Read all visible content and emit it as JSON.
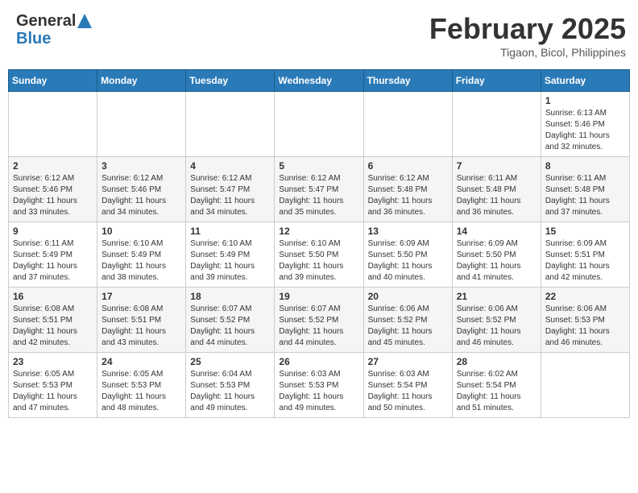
{
  "header": {
    "logo_general": "General",
    "logo_blue": "Blue",
    "month_title": "February 2025",
    "location": "Tigaon, Bicol, Philippines"
  },
  "calendar": {
    "days_of_week": [
      "Sunday",
      "Monday",
      "Tuesday",
      "Wednesday",
      "Thursday",
      "Friday",
      "Saturday"
    ],
    "weeks": [
      [
        {
          "day": "",
          "info": ""
        },
        {
          "day": "",
          "info": ""
        },
        {
          "day": "",
          "info": ""
        },
        {
          "day": "",
          "info": ""
        },
        {
          "day": "",
          "info": ""
        },
        {
          "day": "",
          "info": ""
        },
        {
          "day": "1",
          "info": "Sunrise: 6:13 AM\nSunset: 5:46 PM\nDaylight: 11 hours and 32 minutes."
        }
      ],
      [
        {
          "day": "2",
          "info": "Sunrise: 6:12 AM\nSunset: 5:46 PM\nDaylight: 11 hours and 33 minutes."
        },
        {
          "day": "3",
          "info": "Sunrise: 6:12 AM\nSunset: 5:46 PM\nDaylight: 11 hours and 34 minutes."
        },
        {
          "day": "4",
          "info": "Sunrise: 6:12 AM\nSunset: 5:47 PM\nDaylight: 11 hours and 34 minutes."
        },
        {
          "day": "5",
          "info": "Sunrise: 6:12 AM\nSunset: 5:47 PM\nDaylight: 11 hours and 35 minutes."
        },
        {
          "day": "6",
          "info": "Sunrise: 6:12 AM\nSunset: 5:48 PM\nDaylight: 11 hours and 36 minutes."
        },
        {
          "day": "7",
          "info": "Sunrise: 6:11 AM\nSunset: 5:48 PM\nDaylight: 11 hours and 36 minutes."
        },
        {
          "day": "8",
          "info": "Sunrise: 6:11 AM\nSunset: 5:48 PM\nDaylight: 11 hours and 37 minutes."
        }
      ],
      [
        {
          "day": "9",
          "info": "Sunrise: 6:11 AM\nSunset: 5:49 PM\nDaylight: 11 hours and 37 minutes."
        },
        {
          "day": "10",
          "info": "Sunrise: 6:10 AM\nSunset: 5:49 PM\nDaylight: 11 hours and 38 minutes."
        },
        {
          "day": "11",
          "info": "Sunrise: 6:10 AM\nSunset: 5:49 PM\nDaylight: 11 hours and 39 minutes."
        },
        {
          "day": "12",
          "info": "Sunrise: 6:10 AM\nSunset: 5:50 PM\nDaylight: 11 hours and 39 minutes."
        },
        {
          "day": "13",
          "info": "Sunrise: 6:09 AM\nSunset: 5:50 PM\nDaylight: 11 hours and 40 minutes."
        },
        {
          "day": "14",
          "info": "Sunrise: 6:09 AM\nSunset: 5:50 PM\nDaylight: 11 hours and 41 minutes."
        },
        {
          "day": "15",
          "info": "Sunrise: 6:09 AM\nSunset: 5:51 PM\nDaylight: 11 hours and 42 minutes."
        }
      ],
      [
        {
          "day": "16",
          "info": "Sunrise: 6:08 AM\nSunset: 5:51 PM\nDaylight: 11 hours and 42 minutes."
        },
        {
          "day": "17",
          "info": "Sunrise: 6:08 AM\nSunset: 5:51 PM\nDaylight: 11 hours and 43 minutes."
        },
        {
          "day": "18",
          "info": "Sunrise: 6:07 AM\nSunset: 5:52 PM\nDaylight: 11 hours and 44 minutes."
        },
        {
          "day": "19",
          "info": "Sunrise: 6:07 AM\nSunset: 5:52 PM\nDaylight: 11 hours and 44 minutes."
        },
        {
          "day": "20",
          "info": "Sunrise: 6:06 AM\nSunset: 5:52 PM\nDaylight: 11 hours and 45 minutes."
        },
        {
          "day": "21",
          "info": "Sunrise: 6:06 AM\nSunset: 5:52 PM\nDaylight: 11 hours and 46 minutes."
        },
        {
          "day": "22",
          "info": "Sunrise: 6:06 AM\nSunset: 5:53 PM\nDaylight: 11 hours and 46 minutes."
        }
      ],
      [
        {
          "day": "23",
          "info": "Sunrise: 6:05 AM\nSunset: 5:53 PM\nDaylight: 11 hours and 47 minutes."
        },
        {
          "day": "24",
          "info": "Sunrise: 6:05 AM\nSunset: 5:53 PM\nDaylight: 11 hours and 48 minutes."
        },
        {
          "day": "25",
          "info": "Sunrise: 6:04 AM\nSunset: 5:53 PM\nDaylight: 11 hours and 49 minutes."
        },
        {
          "day": "26",
          "info": "Sunrise: 6:03 AM\nSunset: 5:53 PM\nDaylight: 11 hours and 49 minutes."
        },
        {
          "day": "27",
          "info": "Sunrise: 6:03 AM\nSunset: 5:54 PM\nDaylight: 11 hours and 50 minutes."
        },
        {
          "day": "28",
          "info": "Sunrise: 6:02 AM\nSunset: 5:54 PM\nDaylight: 11 hours and 51 minutes."
        },
        {
          "day": "",
          "info": ""
        }
      ]
    ]
  }
}
